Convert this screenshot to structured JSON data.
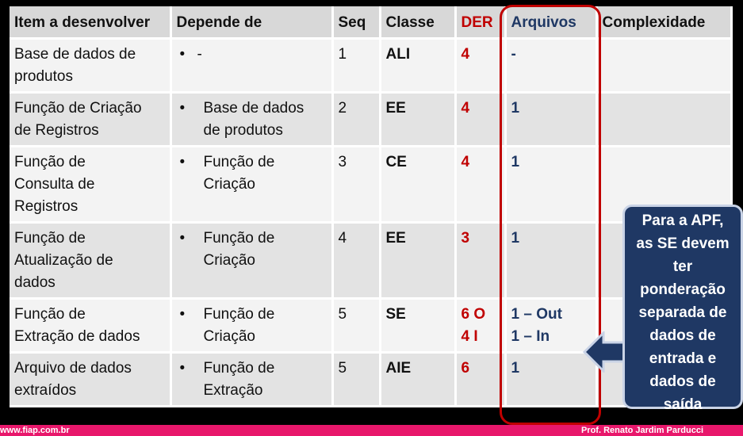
{
  "table": {
    "headers": [
      "Item a desenvolver",
      "Depende de",
      "Seq",
      "Classe",
      "DER",
      "Arquivos",
      "Complexidade"
    ],
    "rows": [
      {
        "item": [
          "Base de dados  de",
          "produtos"
        ],
        "bullet": "•",
        "depende": [
          "-"
        ],
        "seq": "1",
        "classe": "ALI",
        "der": [
          "4"
        ],
        "arquivos": [
          "-"
        ],
        "complexidade": ""
      },
      {
        "item": [
          "Função de Criação",
          "de Registros"
        ],
        "bullet": "•",
        "depende": [
          "Base de dados",
          "de produtos"
        ],
        "seq": "2",
        "classe": "EE",
        "der": [
          "4"
        ],
        "arquivos": [
          "1"
        ],
        "complexidade": ""
      },
      {
        "item": [
          "Função de",
          "Consulta de",
          "Registros"
        ],
        "bullet": "•",
        "depende": [
          "Função de",
          "Criação"
        ],
        "seq": "3",
        "classe": "CE",
        "der": [
          "4"
        ],
        "arquivos": [
          "1"
        ],
        "complexidade": ""
      },
      {
        "item": [
          "Função de",
          "Atualização de",
          "dados"
        ],
        "bullet": "•",
        "depende": [
          "Função de",
          "Criação"
        ],
        "seq": "4",
        "classe": "EE",
        "der": [
          "3"
        ],
        "arquivos": [
          "1"
        ],
        "complexidade": ""
      },
      {
        "item": [
          "Função de",
          "Extração de dados"
        ],
        "bullet": "•",
        "depende": [
          "Função de",
          "Criação"
        ],
        "seq": "5",
        "classe": "SE",
        "der": [
          "6 O",
          "4 I"
        ],
        "arquivos": [
          "1 – Out",
          "1 – In"
        ],
        "complexidade": ""
      },
      {
        "item": [
          "Arquivo de dados",
          "extraídos"
        ],
        "bullet": "•",
        "depende": [
          "Função de",
          "Extração"
        ],
        "seq": "5",
        "classe": "AIE",
        "der": [
          "6"
        ],
        "arquivos": [
          "1"
        ],
        "complexidade": ""
      }
    ]
  },
  "callout": {
    "lines": [
      "Para a APF,",
      "as SE devem",
      "ter",
      "ponderação",
      "separada de",
      "dados de",
      "entrada e",
      "dados de",
      "saída"
    ]
  },
  "footer": {
    "left": "www.fiap.com.br",
    "right": "Prof. Renato Jardim Parducci"
  },
  "colors": {
    "der": "#c00000",
    "arquivos": "#1f3864",
    "highlight": "#c00000",
    "callout_bg": "#1f3864",
    "footer_bg": "#e8176b"
  }
}
